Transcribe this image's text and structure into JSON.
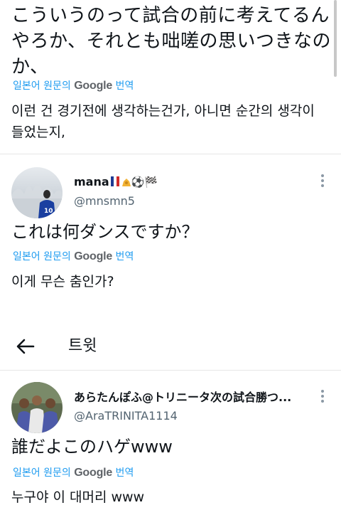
{
  "top_tweet": {
    "text": "こういうのって試合の前に考えてるんやろか、それとも咄嗟の思いつきなのか、",
    "translation_label": {
      "prefix": "일본어 원문의 ",
      "service": "Google",
      "suffix": " 번역"
    },
    "translated_text": "이런 건 경기전에 생각하는건가, 아니면 순간의 생각이 들었는지,"
  },
  "reply_1": {
    "display_name": "mana",
    "name_emoji": "⚽🏁",
    "handle": "@mnsmn5",
    "text": "これは何ダンスですか？",
    "translation_label": {
      "prefix": "일본어 원문의 ",
      "service": "Google",
      "suffix": " 번역"
    },
    "translated_text": "이게 무슨 춤인가?",
    "avatar_jersey_number": "10"
  },
  "header": {
    "back_icon": "arrow-left-icon",
    "title": "트윗"
  },
  "reply_2": {
    "display_name": "あらたんぽふ@トリニータ次の試合勝つ...",
    "handle": "@AraTRINITA1114",
    "text": "誰だよこのハゲwww",
    "translation_label": {
      "prefix": "일본어 원문의 ",
      "service": "Google",
      "suffix": " 번역"
    },
    "translated_text": "누구야 이 대머리 www"
  },
  "colors": {
    "text": "#0f1419",
    "secondary": "#536471",
    "accent": "#1d9bf0",
    "divider": "#e6e6e6"
  }
}
